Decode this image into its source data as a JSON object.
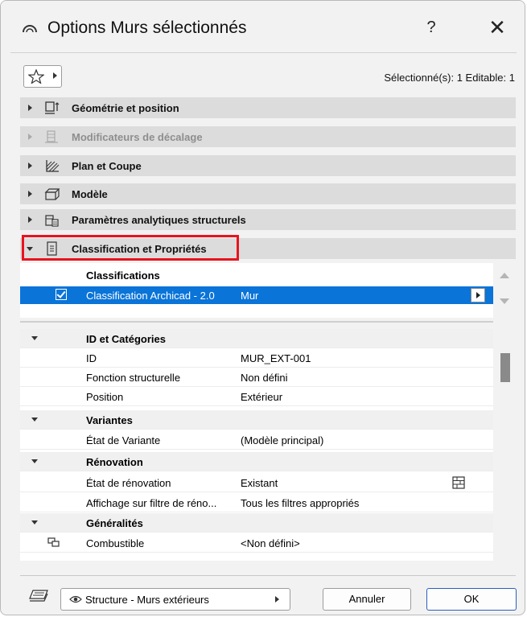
{
  "window": {
    "title": "Options Murs sélectionnés",
    "help_label": "?",
    "close_label": "✕"
  },
  "toolbar": {
    "favorites_icon": "star-icon",
    "selection_info": "Sélectionné(s): 1 Editable: 1"
  },
  "panels": [
    {
      "label": "Géométrie et position",
      "icon": "geometry-icon",
      "state": "collapsed",
      "enabled": true
    },
    {
      "label": "Modificateurs de décalage",
      "icon": "offset-modifier-icon",
      "state": "collapsed",
      "enabled": false
    },
    {
      "label": "Plan et Coupe",
      "icon": "floorplan-section-icon",
      "state": "collapsed",
      "enabled": true
    },
    {
      "label": "Modèle",
      "icon": "model-icon",
      "state": "collapsed",
      "enabled": true
    },
    {
      "label": "Paramètres analytiques structurels",
      "icon": "structural-analytics-icon",
      "state": "collapsed",
      "enabled": true
    },
    {
      "label": "Classification et Propriétés",
      "icon": "document-icon",
      "state": "expanded",
      "enabled": true,
      "highlighted": true
    }
  ],
  "classifications": {
    "header": "Classifications",
    "rows": [
      {
        "name": "Classification Archicad - 2.0",
        "value": "Mur",
        "checked": true,
        "selected": true
      }
    ]
  },
  "properties": {
    "groups": [
      {
        "label": "ID et Catégories",
        "rows": [
          {
            "key": "ID",
            "value": "MUR_EXT-001"
          },
          {
            "key": "Fonction structurelle",
            "value": "Non défini"
          },
          {
            "key": "Position",
            "value": "Extérieur"
          }
        ]
      },
      {
        "label": "Variantes",
        "rows": [
          {
            "key": "État de Variante",
            "value": "(Modèle principal)"
          }
        ]
      },
      {
        "label": "Rénovation",
        "rows": [
          {
            "key": "État de rénovation",
            "value": "Existant",
            "icon": "renovation-icon"
          },
          {
            "key": "Affichage sur filtre de réno...",
            "value": "Tous les filtres appropriés"
          }
        ]
      },
      {
        "label": "Généralités",
        "rows": [
          {
            "key": "Combustible",
            "value": "<Non défini>",
            "icon": "link-icon"
          }
        ]
      }
    ]
  },
  "footer": {
    "layer_icon": "layer-icon",
    "layer_name": "Structure - Murs extérieurs",
    "cancel_label": "Annuler",
    "ok_label": "OK"
  },
  "colors": {
    "selection": "#0a74d8",
    "highlight_border": "#e8141e",
    "panel_bg": "#dcdcdc",
    "dialog_bg": "#f2f2f2"
  }
}
